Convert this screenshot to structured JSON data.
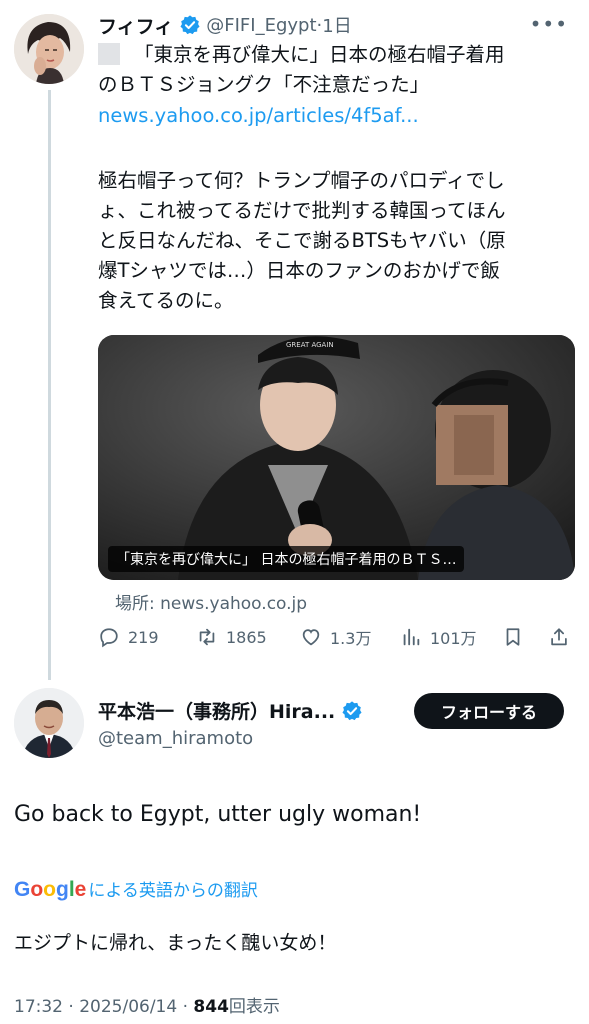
{
  "tweet": {
    "author_name": "フィフィ",
    "handle": "@FIFI_Egypt",
    "dot": "·",
    "time": "1日",
    "more_icon": "more-dots-icon",
    "text_line1": "「東京を再び偉大に」日本の極右帽子着用",
    "text_line2": "のＢＴＳジョングク「不注意だった」",
    "link": "news.yahoo.co.jp/articles/4f5af...",
    "body_line1": "極右帽子って何？トランプ帽子のパロディでし",
    "body_line2": "ょ、これ被ってるだけで批判する韓国ってほん",
    "body_line3": "と反日なんだね、そこで謝るBTSもヤバい（原",
    "body_line4": "爆Tシャツでは…）日本のファンのおかげで飯",
    "body_line5": "食えてるのに。",
    "card_caption": "「東京を再び偉大に」 日本の極右帽子着用のＢＴＳ…",
    "card_source": "場所: news.yahoo.co.jp",
    "cap_text": "GREAT AGAIN",
    "actions": {
      "replies": "219",
      "retweets": "1865",
      "likes": "1.3万",
      "views": "101万"
    }
  },
  "reply": {
    "author_name": "平本浩一（事務所）Hira...",
    "handle": "@team_hiramoto",
    "follow_label": "フォローする",
    "text": "Go back to Egypt, utter ugly woman!",
    "google_logo": "Google",
    "translate_label": "による英語からの翻訳",
    "translated_text": "エジプトに帰れ、まったく醜い女め！",
    "timestamp": "17:32 · 2025/06/14 · ",
    "view_count": "844",
    "view_label": "回表示"
  },
  "colors": {
    "accent": "#1d9bf0",
    "text": "#0f1419",
    "secondary": "#536471",
    "verified": "#1d9bf0"
  }
}
